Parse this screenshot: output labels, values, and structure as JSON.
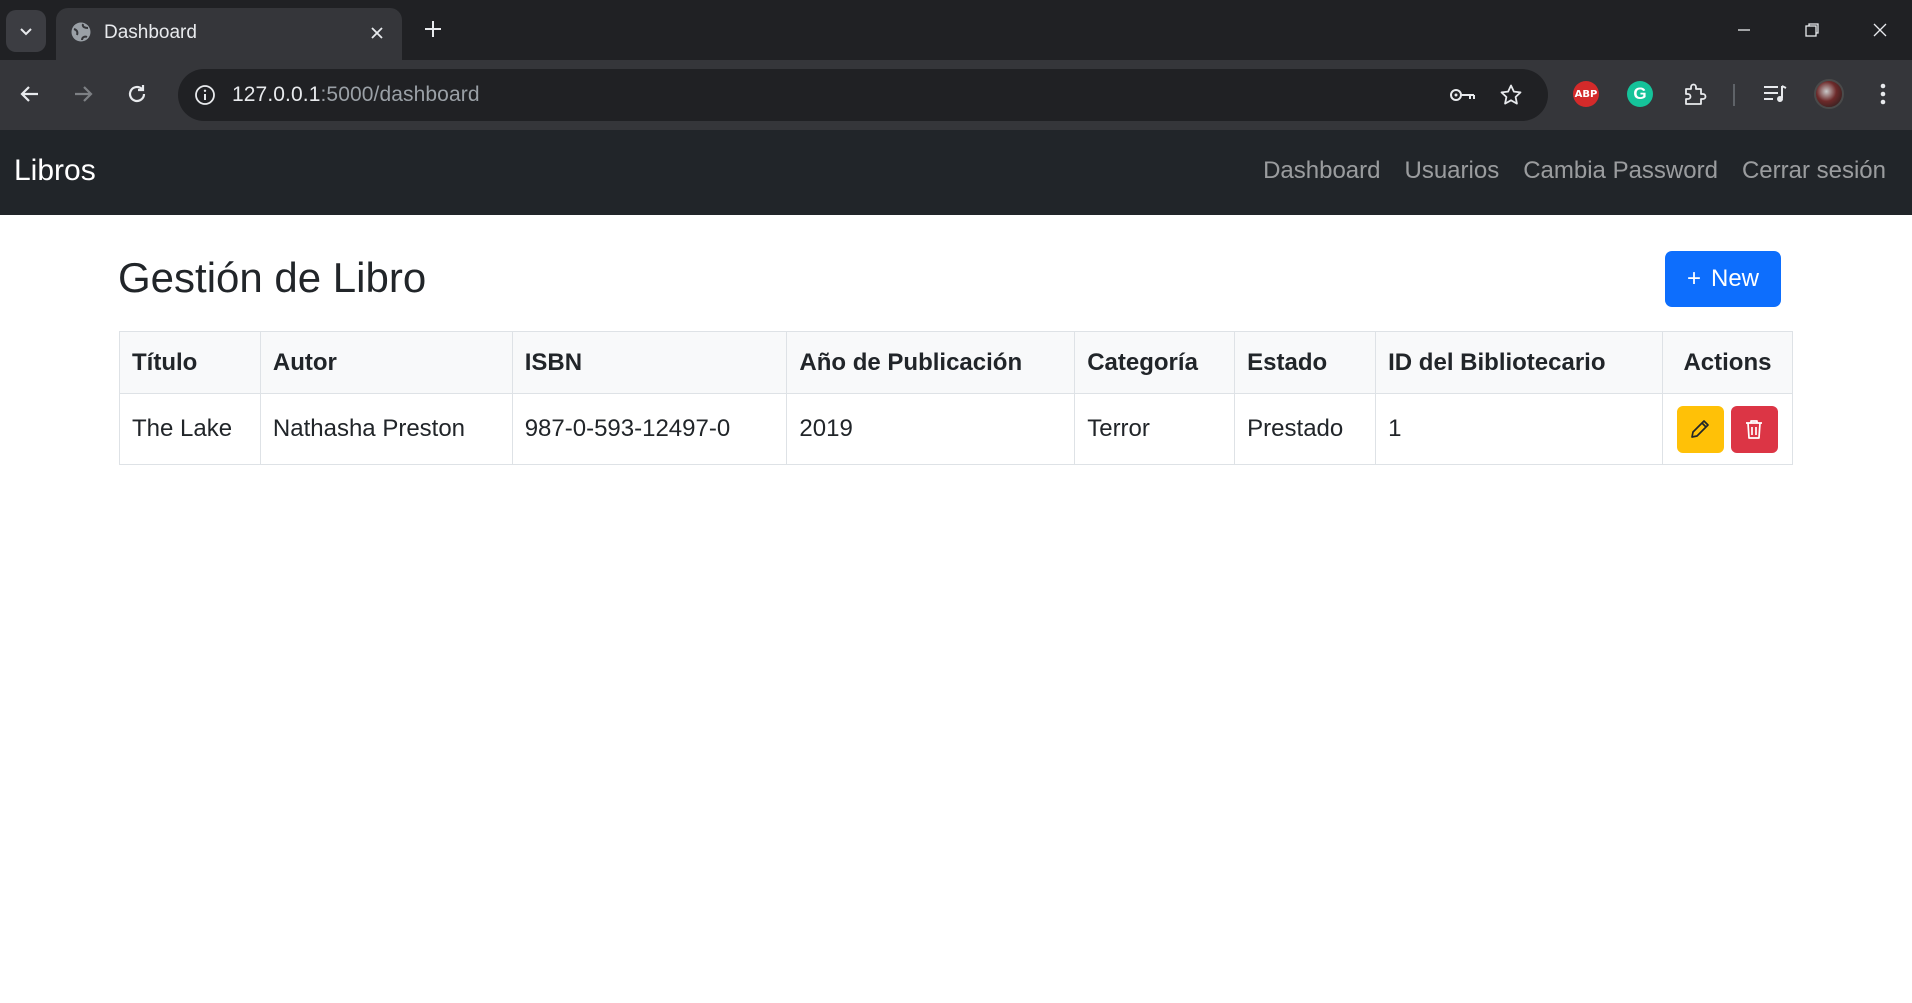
{
  "browser": {
    "tab_title": "Dashboard",
    "url_host": "127.0.0.1",
    "url_rest": ":5000/dashboard",
    "extensions": {
      "abp_label": "ABP",
      "grammarly_label": "G"
    }
  },
  "navbar": {
    "brand": "Libros",
    "links": [
      "Dashboard",
      "Usuarios",
      "Cambia Password",
      "Cerrar sesión"
    ]
  },
  "page": {
    "title": "Gestión de Libro",
    "new_button_icon": "+",
    "new_button_label": "New"
  },
  "table": {
    "headers": [
      "Título",
      "Autor",
      "ISBN",
      "Año de Publicación",
      "Categoría",
      "Estado",
      "ID del Bibliotecario",
      "Actions"
    ],
    "rows": [
      [
        "The Lake",
        "Nathasha Preston",
        "987-0-593-12497-0",
        "2019",
        "Terror",
        "Prestado",
        "1"
      ]
    ],
    "row_actions": [
      "pencil-icon",
      "trash-icon"
    ]
  },
  "colors": {
    "primary": "#0d6efd",
    "warning": "#ffc107",
    "danger": "#dc3545",
    "navbar": "#212529"
  }
}
